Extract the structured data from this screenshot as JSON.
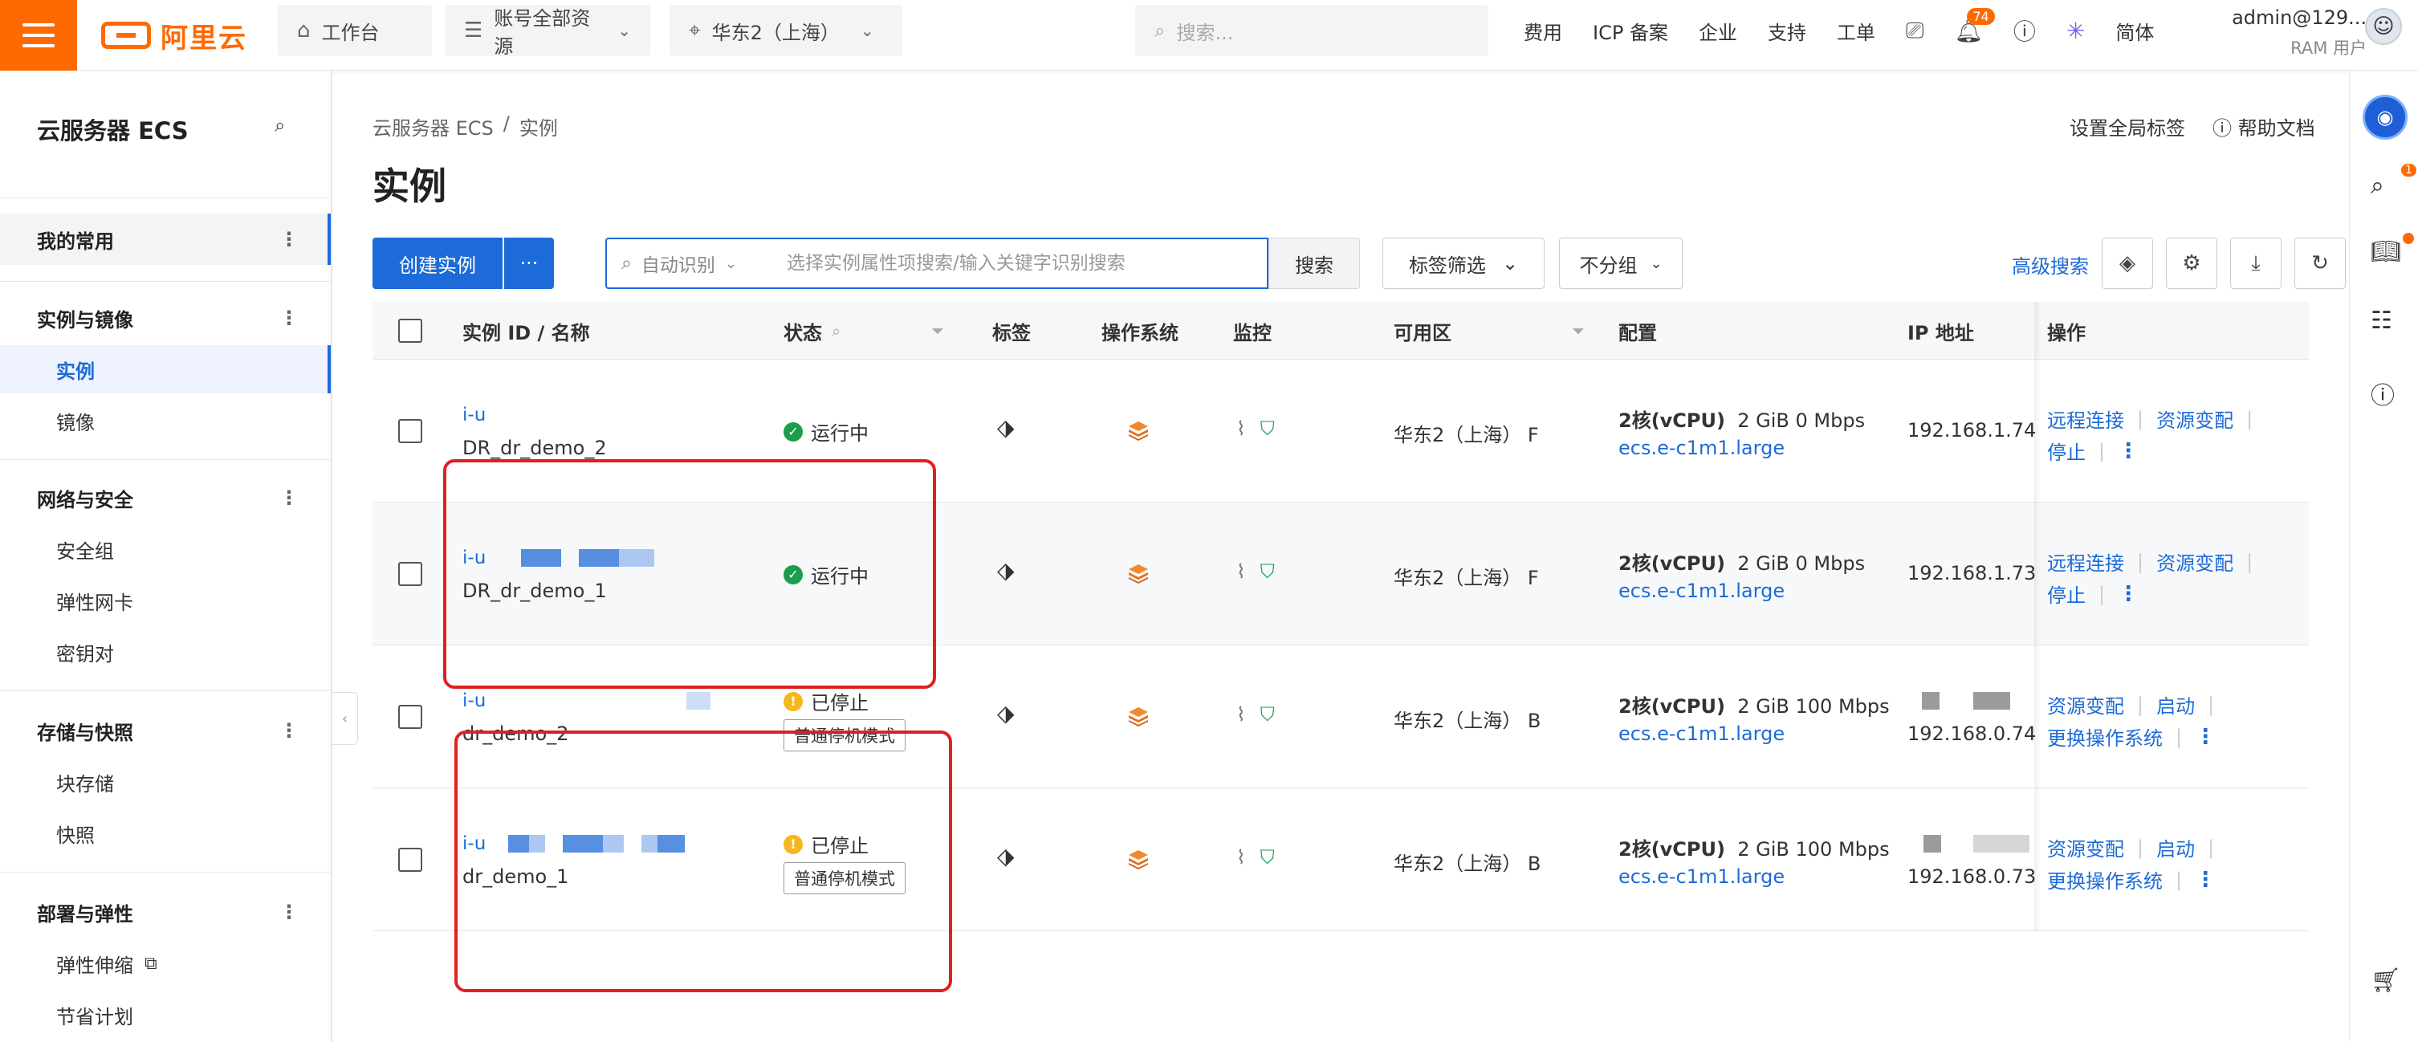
{
  "topbar": {
    "logo_text": "阿里云",
    "workbench": "工作台",
    "resources": "账号全部资源",
    "region": "华东2（上海）",
    "search_placeholder": "搜索...",
    "links": [
      "费用",
      "ICP 备案",
      "企业",
      "支持",
      "工单"
    ],
    "notification_count": "74",
    "lang": "简体",
    "user_name": "admin@129...",
    "user_role": "RAM 用户"
  },
  "sidebar": {
    "title": "云服务器 ECS",
    "favorites": "我的常用",
    "groups": [
      {
        "label": "实例与镜像",
        "items": [
          "实例",
          "镜像"
        ]
      },
      {
        "label": "网络与安全",
        "items": [
          "安全组",
          "弹性网卡",
          "密钥对"
        ]
      },
      {
        "label": "存储与快照",
        "items": [
          "块存储",
          "快照"
        ]
      },
      {
        "label": "部署与弹性",
        "items": [
          "弹性伸缩",
          "节省计划"
        ]
      }
    ]
  },
  "main": {
    "breadcrumb": [
      "云服务器 ECS",
      "/",
      "实例"
    ],
    "title": "实例",
    "header_links": [
      "设置全局标签",
      "帮助文档"
    ],
    "toolbar": {
      "create": "创建实例",
      "more": "···",
      "search_mode": "自动识别",
      "search_placeholder": "选择实例属性项搜索/输入关键字识别搜索",
      "search_btn": "搜索",
      "tag_filter": "标签筛选",
      "group": "不分组",
      "advanced": "高级搜索"
    },
    "columns": [
      "实例 ID / 名称",
      "状态",
      "标签",
      "操作系统",
      "监控",
      "可用区",
      "配置",
      "IP 地址",
      "操作"
    ],
    "rows": [
      {
        "id_prefix": "i-u",
        "name": "DR_dr_demo_2",
        "status": "运行中",
        "mode": "",
        "zone": "华东2（上海） F",
        "config_main": "2核(vCPU)",
        "config_mem": "2 GiB 0 Mbps",
        "type": "ecs.e-c1m1.large",
        "ip": "192.168.1.74",
        "ops": [
          "远程连接",
          "资源变配",
          "停止"
        ]
      },
      {
        "id_prefix": "i-u",
        "name": "DR_dr_demo_1",
        "status": "运行中",
        "mode": "",
        "zone": "华东2（上海） F",
        "config_main": "2核(vCPU)",
        "config_mem": "2 GiB 0 Mbps",
        "type": "ecs.e-c1m1.large",
        "ip": "192.168.1.73",
        "ops": [
          "远程连接",
          "资源变配",
          "停止"
        ]
      },
      {
        "id_prefix": "i-u",
        "name": "dr_demo_2",
        "status": "已停止",
        "mode": "普通停机模式",
        "zone": "华东2（上海） B",
        "config_main": "2核(vCPU)",
        "config_mem": "2 GiB 100 Mbps",
        "type": "ecs.e-c1m1.large",
        "ip": "192.168.0.74",
        "ops": [
          "资源变配",
          "启动",
          "更换操作系统"
        ]
      },
      {
        "id_prefix": "i-u",
        "name": "dr_demo_1",
        "status": "已停止",
        "mode": "普通停机模式",
        "zone": "华东2（上海） B",
        "config_main": "2核(vCPU)",
        "config_mem": "2 GiB 100 Mbps",
        "type": "ecs.e-c1m1.large",
        "ip": "192.168.0.73",
        "ops": [
          "资源变配",
          "启动",
          "更换操作系统"
        ]
      }
    ]
  },
  "rail": {
    "cart_badge": "1"
  },
  "colors": {
    "brand": "#ff6a00",
    "primary": "#1c6bd8",
    "running": "#1a9d4d",
    "stopped": "#f5b71c",
    "highlight": "#e02020"
  }
}
